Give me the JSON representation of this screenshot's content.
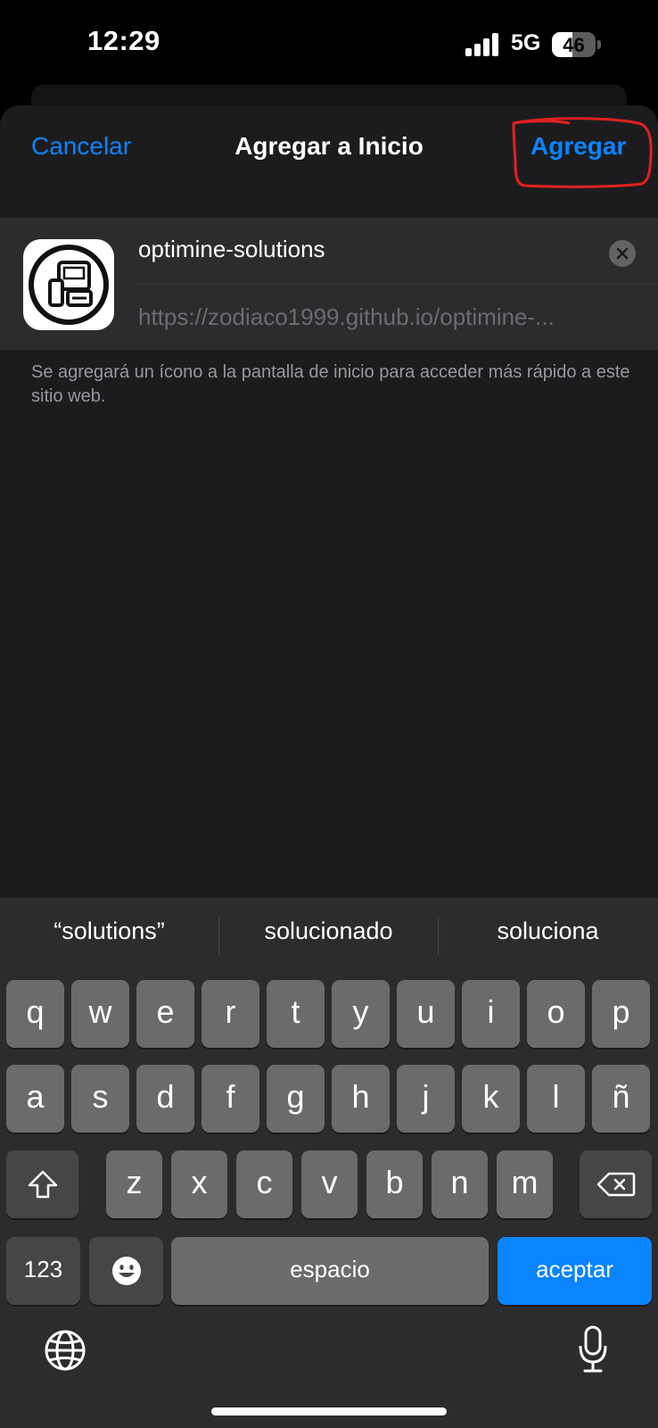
{
  "status_bar": {
    "time": "12:29",
    "network": "5G",
    "battery": "46",
    "battery_level_percent": 46
  },
  "sheet": {
    "cancel_label": "Cancelar",
    "title": "Agregar a Inicio",
    "add_label": "Agregar",
    "name_value": "optimine-solutions",
    "url_value": "https://zodiaco1999.github.io/optimine-...",
    "hint": "Se agregará un ícono a la pantalla de inicio para acceder más rápido a este sitio web."
  },
  "keyboard": {
    "suggestions": [
      "“solutions”",
      "solucionado",
      "soluciona"
    ],
    "row1": [
      "q",
      "w",
      "e",
      "r",
      "t",
      "y",
      "u",
      "i",
      "o",
      "p"
    ],
    "row2": [
      "a",
      "s",
      "d",
      "f",
      "g",
      "h",
      "j",
      "k",
      "l",
      "ñ"
    ],
    "row3": [
      "z",
      "x",
      "c",
      "v",
      "b",
      "n",
      "m"
    ],
    "numbers_key": "123",
    "space_key": "espacio",
    "return_key": "aceptar"
  },
  "icons": {
    "shift": "shift-icon",
    "delete": "backspace-icon",
    "emoji": "emoji-icon",
    "globe": "globe-icon",
    "mic": "microphone-icon",
    "clear": "clear-text-icon"
  },
  "colors": {
    "accent": "#0a84ff",
    "annotation": "#e02020"
  }
}
